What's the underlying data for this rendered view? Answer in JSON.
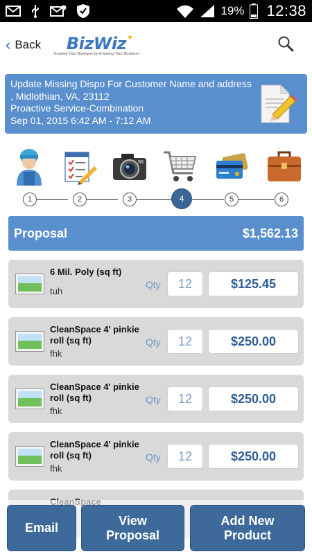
{
  "status_bar": {
    "battery": "19%",
    "time": "12:38",
    "icons": [
      "mail-icon",
      "usb-icon",
      "mail-alert-icon",
      "shield-icon",
      "wifi-icon",
      "signal-icon",
      "battery-icon"
    ]
  },
  "app_bar": {
    "back_label": "Back",
    "logo_text": "BizWiz",
    "logo_tagline": "Growing Your Business by Knowing Your Business",
    "search_icon": "search-icon"
  },
  "job": {
    "line1": "Update Missing Dispo For Customer Name and address",
    "line2": ", Midlothian, VA, 23112",
    "line3": "Proactive Service-Combination",
    "line4": "Sep 01, 2015 6:42 AM -  7:12 AM",
    "icon": "edit-document-icon"
  },
  "steps": [
    {
      "number": "1",
      "icon": "technician-icon"
    },
    {
      "number": "2",
      "icon": "checklist-icon"
    },
    {
      "number": "3",
      "icon": "camera-icon"
    },
    {
      "number": "4",
      "icon": "cart-icon"
    },
    {
      "number": "5",
      "icon": "payment-card-icon"
    },
    {
      "number": "6",
      "icon": "briefcase-icon"
    }
  ],
  "active_step": 4,
  "proposal": {
    "title": "Proposal",
    "total": "$1,562.13"
  },
  "qty_label": "Qty",
  "items": [
    {
      "name": "6 Mil. Poly (sq ft)",
      "note": "tuh",
      "qty": "12",
      "price": "$125.45"
    },
    {
      "name": "CleanSpace 4' pinkie roll (sq ft)",
      "note": "fhk",
      "qty": "12",
      "price": "$250.00"
    },
    {
      "name": "CleanSpace 4' pinkie roll (sq ft)",
      "note": "fhk",
      "qty": "12",
      "price": "$250.00"
    },
    {
      "name": "CleanSpace 4' pinkie roll (sq ft)",
      "note": "fhk",
      "qty": "12",
      "price": "$250.00"
    },
    {
      "name": "CleanSpace",
      "note": "",
      "qty": "",
      "price": ""
    }
  ],
  "actions": {
    "email": "Email",
    "view_proposal": "View Proposal",
    "add_product": "Add New Product"
  },
  "colors": {
    "accent": "#5a8fce",
    "button": "#3d6a9a",
    "price_text": "#2e5e96"
  }
}
